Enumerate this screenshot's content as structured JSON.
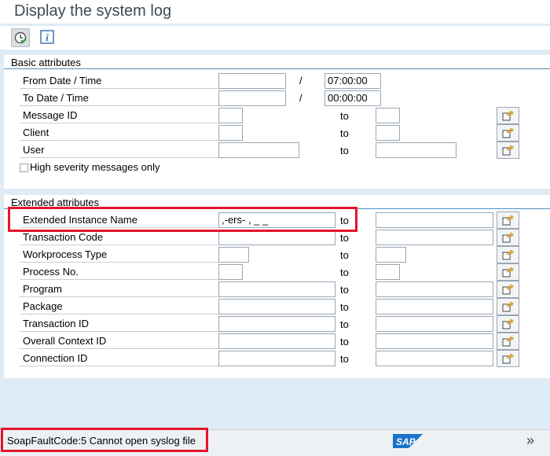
{
  "title": "Display the system log",
  "toolbar": {
    "execute_icon": "execute-clock-icon",
    "info_icon": "info-icon"
  },
  "basic": {
    "title": "Basic attributes",
    "from_label": "From Date / Time",
    "from_date": "",
    "from_sep": "/",
    "from_time": "07:00:00",
    "to_label": "To Date / Time",
    "to_date": "",
    "to_sep": "/",
    "to_time": "00:00:00",
    "msgid_label": "Message ID",
    "client_label": "Client",
    "user_label": "User",
    "to_word": "to",
    "checkbox_label": "High severity messages only"
  },
  "extended": {
    "title": "Extended attributes",
    "instance_label": "Extended Instance Name",
    "instance_value": ",-ers-   ,  _   _",
    "tcode_label": "Transaction Code",
    "wptype_label": "Workprocess Type",
    "procno_label": "Process No.",
    "program_label": "Program",
    "package_label": "Package",
    "transid_label": "Transaction ID",
    "ctxid_label": "Overall Context ID",
    "connid_label": "Connection ID",
    "to_word": "to"
  },
  "status": {
    "message": "SoapFaultCode:5  Cannot open syslog file",
    "logo": "SAP"
  },
  "colors": {
    "highlight": "#e3162b",
    "group_line": "#4f8fbf"
  }
}
